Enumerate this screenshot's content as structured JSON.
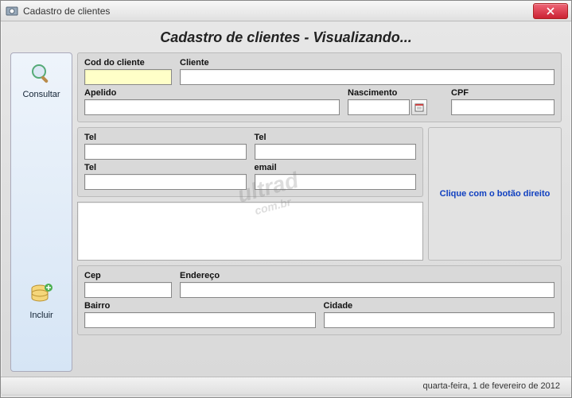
{
  "window": {
    "title": "Cadastro de clientes"
  },
  "header": {
    "title": "Cadastro de clientes - Visualizando..."
  },
  "sidebar": {
    "consultar": {
      "label": "Consultar"
    },
    "incluir": {
      "label": "Incluir"
    }
  },
  "section1": {
    "cod_label": "Cod do cliente",
    "cliente_label": "Cliente",
    "apelido_label": "Apelido",
    "nascimento_label": "Nascimento",
    "cpf_label": "CPF",
    "cod_value": "",
    "cliente_value": "",
    "apelido_value": "",
    "nascimento_value": "",
    "cpf_value": ""
  },
  "section2": {
    "tel1_label": "Tel",
    "tel1_value": "",
    "tel2_label": "Tel",
    "tel2_value": "",
    "tel3_label": "Tel",
    "tel3_value": "",
    "email_label": "email",
    "email_value": ""
  },
  "rightbox": {
    "text": "Clique com o botão direito"
  },
  "section3": {
    "cep_label": "Cep",
    "cep_value": "",
    "endereco_label": "Endereço",
    "endereco_value": "",
    "bairro_label": "Bairro",
    "bairro_value": "",
    "cidade_label": "Cidade",
    "cidade_value": ""
  },
  "statusbar": {
    "date": "quarta-feira, 1 de fevereiro de 2012"
  },
  "watermark": {
    "line1": "ultrad",
    "line2": "com.br"
  }
}
